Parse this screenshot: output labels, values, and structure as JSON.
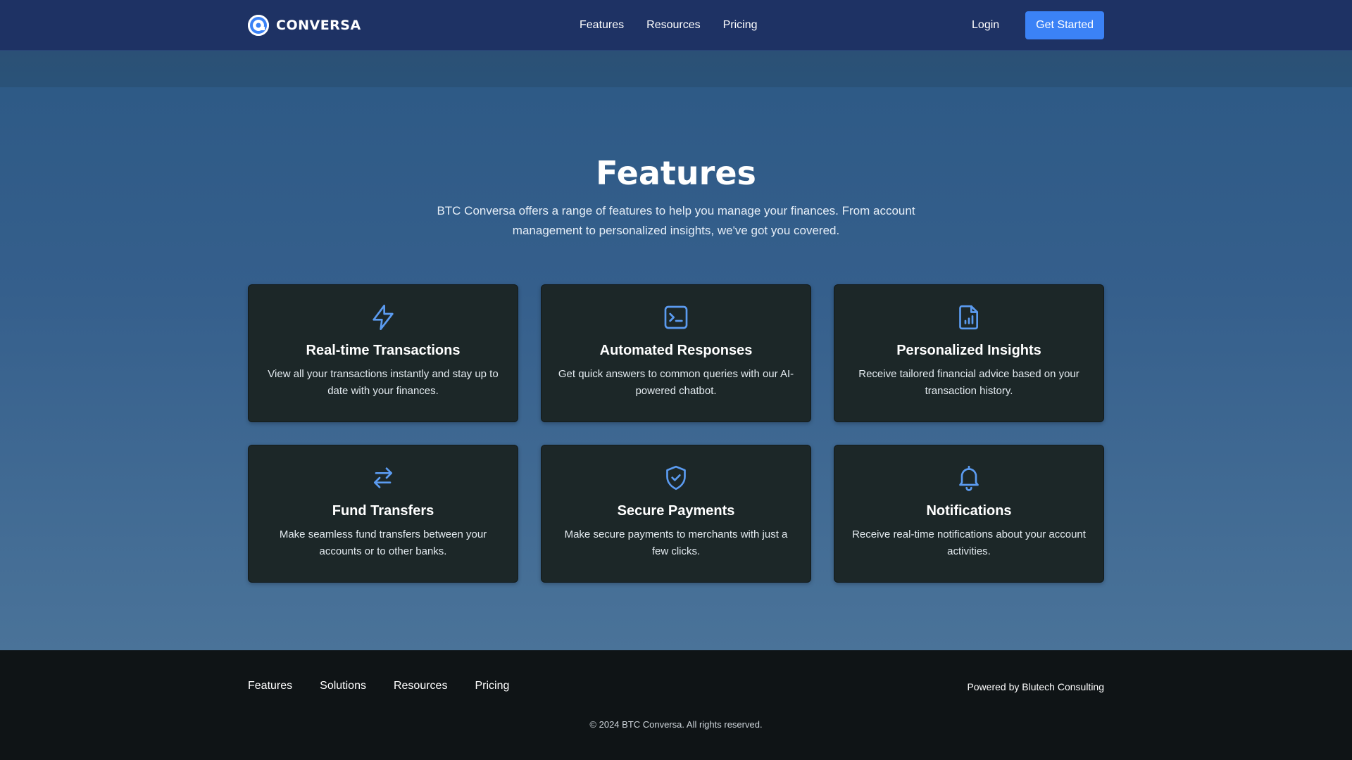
{
  "navbar": {
    "brand": "CONVERSA",
    "links": [
      "Features",
      "Resources",
      "Pricing"
    ],
    "login": "Login",
    "cta": "Get Started"
  },
  "hero": {
    "title": "Features",
    "subtitle": "BTC Conversa offers a range of features to help you manage your finances. From account management to personalized insights, we've got you covered."
  },
  "features": [
    {
      "icon": "lightning-icon",
      "title": "Real-time Transactions",
      "description": "View all your transactions instantly and stay up to date with your finances."
    },
    {
      "icon": "terminal-icon",
      "title": "Automated Responses",
      "description": "Get quick answers to common queries with our AI-powered chatbot."
    },
    {
      "icon": "document-chart-icon",
      "title": "Personalized Insights",
      "description": "Receive tailored financial advice based on your transaction history."
    },
    {
      "icon": "transfer-arrows-icon",
      "title": "Fund Transfers",
      "description": "Make seamless fund transfers between your accounts or to other banks."
    },
    {
      "icon": "shield-check-icon",
      "title": "Secure Payments",
      "description": "Make secure payments to merchants with just a few clicks."
    },
    {
      "icon": "bell-icon",
      "title": "Notifications",
      "description": "Receive real-time notifications about your account activities."
    }
  ],
  "footer": {
    "links": [
      "Features",
      "Solutions",
      "Resources",
      "Pricing"
    ],
    "powered_by": "Powered by Blutech Consulting",
    "copyright": "© 2024 BTC Conversa. All rights reserved."
  },
  "colors": {
    "accent": "#3b82f6",
    "icon": "#5b9bf0",
    "navbar": "#1e3264",
    "card": "#1c2728",
    "footer": "#0f1416"
  }
}
